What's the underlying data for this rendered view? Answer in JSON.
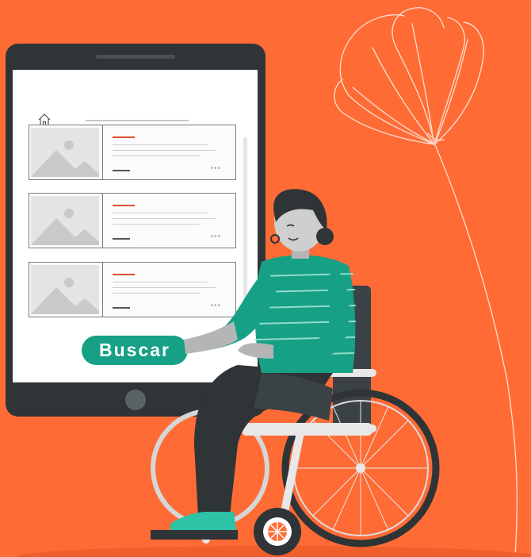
{
  "search_button": {
    "label": "Buscar"
  },
  "icons": {
    "home": "home-icon",
    "flower": "flower-icon"
  },
  "colors": {
    "background": "#ff6b35",
    "tablet": "#2f3437",
    "button": "#16a085",
    "shirt": "#16a085"
  },
  "result_cards": [
    {
      "thumbnail": "image-placeholder-icon"
    },
    {
      "thumbnail": "image-placeholder-icon"
    },
    {
      "thumbnail": "image-placeholder-icon"
    }
  ]
}
